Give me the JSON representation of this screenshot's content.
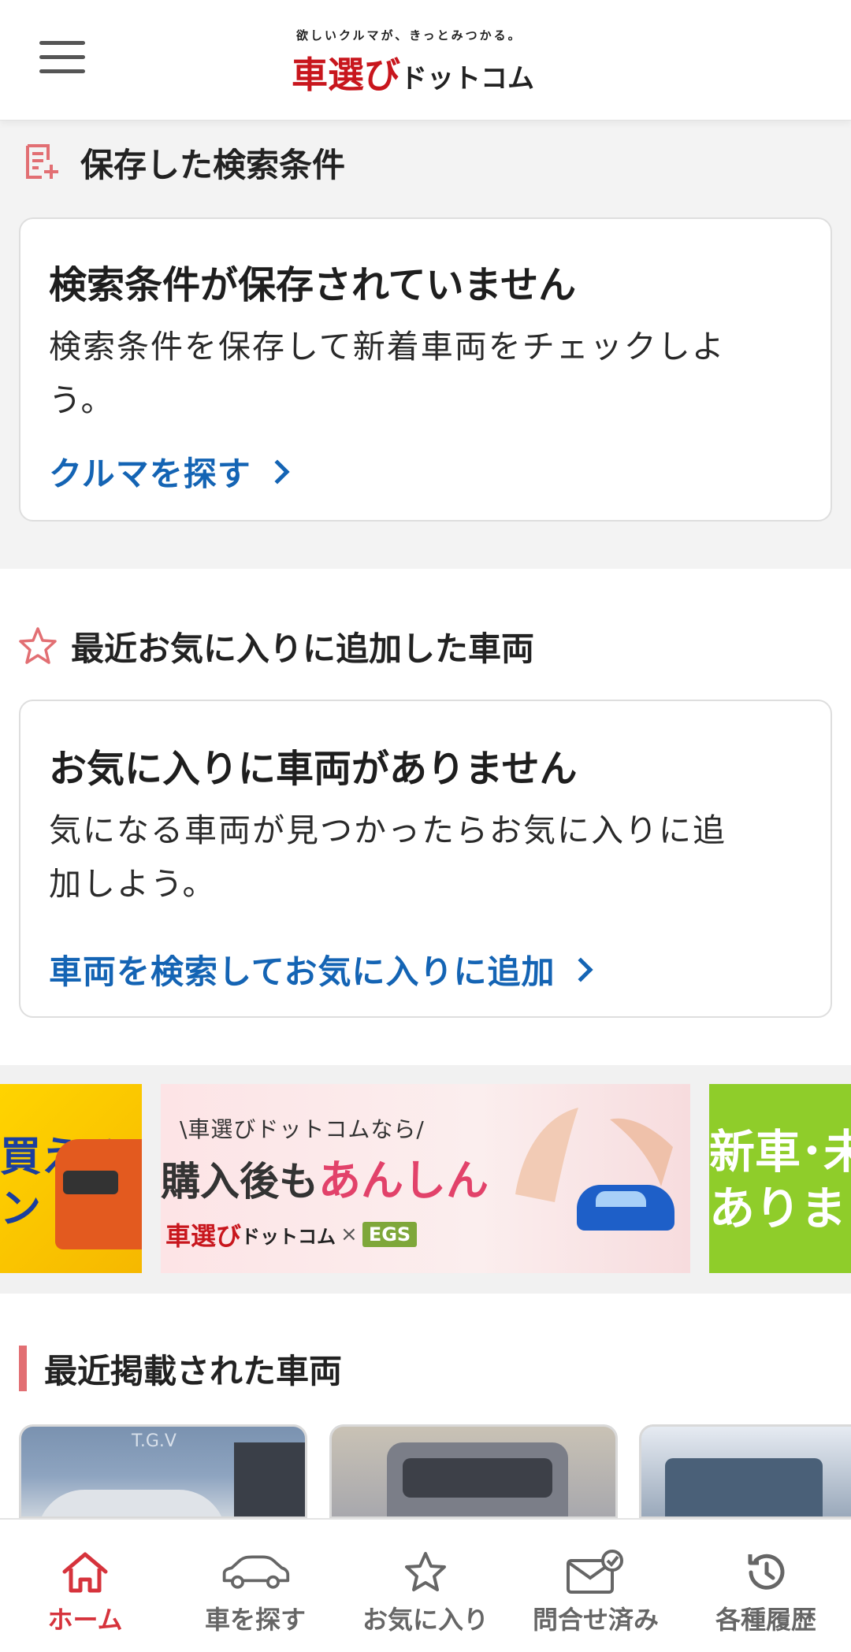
{
  "header": {
    "tagline": "欲しいクルマが、きっとみつかる。",
    "logo_red": "車選び",
    "logo_black": "ドットコム"
  },
  "saved_search": {
    "section_title": "保存した検索条件",
    "card_title": "検索条件が保存されていません",
    "card_desc": "検索条件を保存して新着車両をチェックしよう。",
    "link": "クルマを探す"
  },
  "favorites": {
    "section_title": "最近お気に入りに追加した車両",
    "card_title": "お気に入りに車両がありません",
    "card_desc": "気になる車両が見つかったらお気に入りに追加しよう。",
    "link": "車両を検索してお気に入りに追加"
  },
  "banners": {
    "left_text": "買える\nン",
    "center_sub": "\\車選びドットコムなら/",
    "center_main_a": "購入後も",
    "center_main_b": "あんしん",
    "center_brand_red": "車選び",
    "center_brand_black": "ドットコム",
    "center_brand_x": "×",
    "center_brand_egs": "EGS",
    "right_text_1": "新車･未",
    "right_text_2": "ありま"
  },
  "recent": {
    "section_title": "最近掲載された車両",
    "thumb1_overlay": "T.G.V"
  },
  "bottom_nav": {
    "home": "ホーム",
    "search": "車を探す",
    "favorites": "お気に入り",
    "inquired": "問合せ済み",
    "history": "各種履歴"
  },
  "colors": {
    "brand_red": "#c8161d",
    "link_blue": "#1464b4",
    "active_red": "#d6333c",
    "accent_pink": "#e26f73"
  }
}
